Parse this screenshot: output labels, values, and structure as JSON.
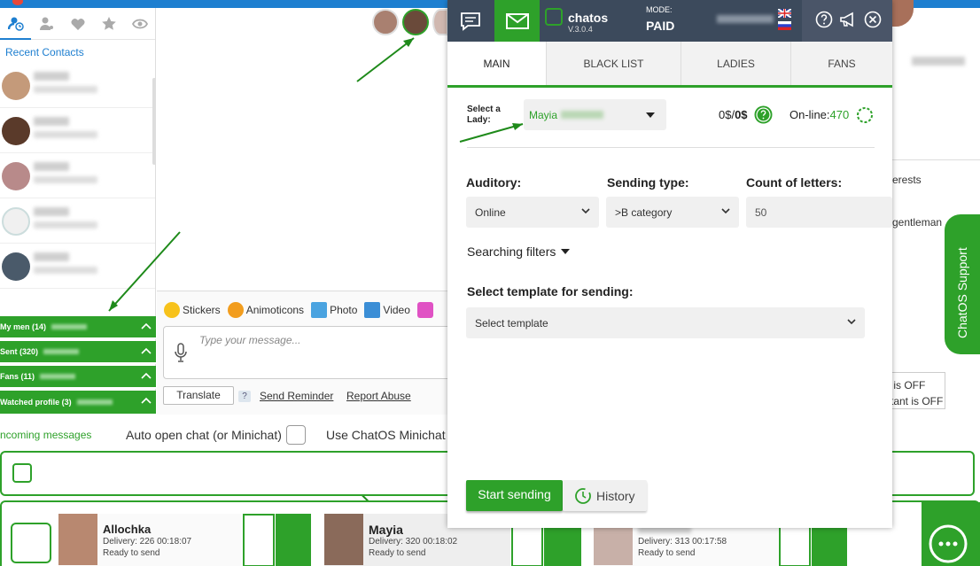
{
  "sidebar": {
    "recent_title": "Recent Contacts",
    "groups": [
      {
        "label": "My men (14)"
      },
      {
        "label": "Sent (320)"
      },
      {
        "label": "Fans (11)"
      },
      {
        "label": "Watched profile (3)"
      }
    ]
  },
  "composer": {
    "tools": [
      "Stickers",
      "Animoticons",
      "Photo",
      "Video"
    ],
    "placeholder": "Type your message...",
    "translate": "Translate",
    "help": "?",
    "send_reminder": "Send Reminder",
    "report_abuse": "Report Abuse"
  },
  "bottom": {
    "incoming": "ncoming messages",
    "auto_open": "Auto open chat (or Minichat)",
    "use_minichat": "Use ChatOS Minichat"
  },
  "cards": [
    {
      "name": "Allochka",
      "delivery": "Delivery: 226  00:18:07",
      "status": "Ready to send"
    },
    {
      "name": "Mayia",
      "delivery": "Delivery: 320  00:18:02",
      "status": "Ready to send"
    },
    {
      "name": "",
      "delivery": "Delivery: 313  00:17:58",
      "status": "Ready to send"
    }
  ],
  "panel": {
    "brand": "chatos",
    "version": "V.3.0.4",
    "mode_label": "MODE:",
    "mode_value": "PAID",
    "tabs": [
      "MAIN",
      "BLACK LIST",
      "LADIES",
      "FANS"
    ],
    "active_tab": "MAIN",
    "select_lady_label": "Select a Lady:",
    "lady_value": "Mayia",
    "money": "0$/",
    "money_bold": "0$",
    "online_label": "On-line:",
    "online_value": "470",
    "auditory_label": "Auditory:",
    "auditory_value": "Online",
    "sending_type_label": "Sending type:",
    "sending_type_value": ">B category",
    "count_label": "Count of letters:",
    "count_value": "50",
    "searching_filters": "Searching filters",
    "template_label": "Select template for sending:",
    "template_placeholder": "Select template",
    "start_button": "Start sending",
    "history_button": "History"
  },
  "right_bg": {
    "interests": "erests",
    "gentleman": "gentleman",
    "status1": "s is OFF",
    "status2": "stant is OFF",
    "support": "ChatOS Support"
  },
  "colors": {
    "accent": "#2ea12a",
    "header": "#3c4a5c",
    "link": "#1e7fd0"
  }
}
